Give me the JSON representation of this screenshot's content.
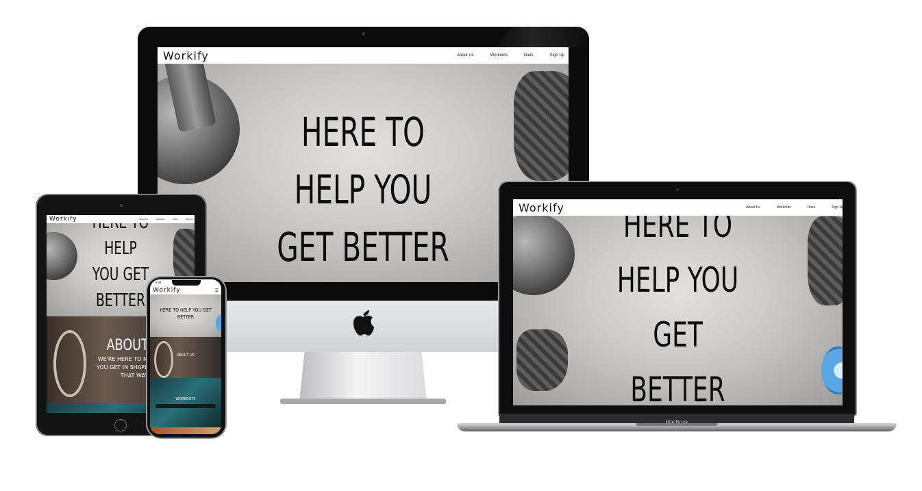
{
  "site": {
    "logo": "Workify",
    "nav": [
      "About Us",
      "Workouts",
      "Diets",
      "Sign Up"
    ],
    "hero_lines_desktop": [
      "HERE TO",
      "HELP YOU",
      "GET BETTER"
    ],
    "hero_lines_laptop": [
      "HERE TO",
      "HELP YOU",
      "GET",
      "BETTER"
    ],
    "hero_lines_tablet": [
      "HERE TO",
      "HELP",
      "YOU GET",
      "BETTER"
    ],
    "hero_text_phone": "HERE TO HELP YOU GET BETTER",
    "about_title": "ABOUT US",
    "about_text_lines": [
      "WE'RE HERE TO NOT ONLY",
      "YOU GET IN SHAPE, BUT TO",
      "THAT WAY"
    ],
    "phone_about_title": "ABOUT US",
    "phone_workouts_title": "WORKOUTS"
  },
  "devices": {
    "laptop_brand": "MacBook",
    "phone_time": "9:41"
  },
  "colors": {
    "nav_bg": "#ffffff",
    "text": "#0c0c0c",
    "device_black": "#0b0b0b",
    "aluminum": "#d2d3d6"
  },
  "icons": [
    "apple-logo-icon",
    "camera-icon",
    "home-button-icon"
  ]
}
